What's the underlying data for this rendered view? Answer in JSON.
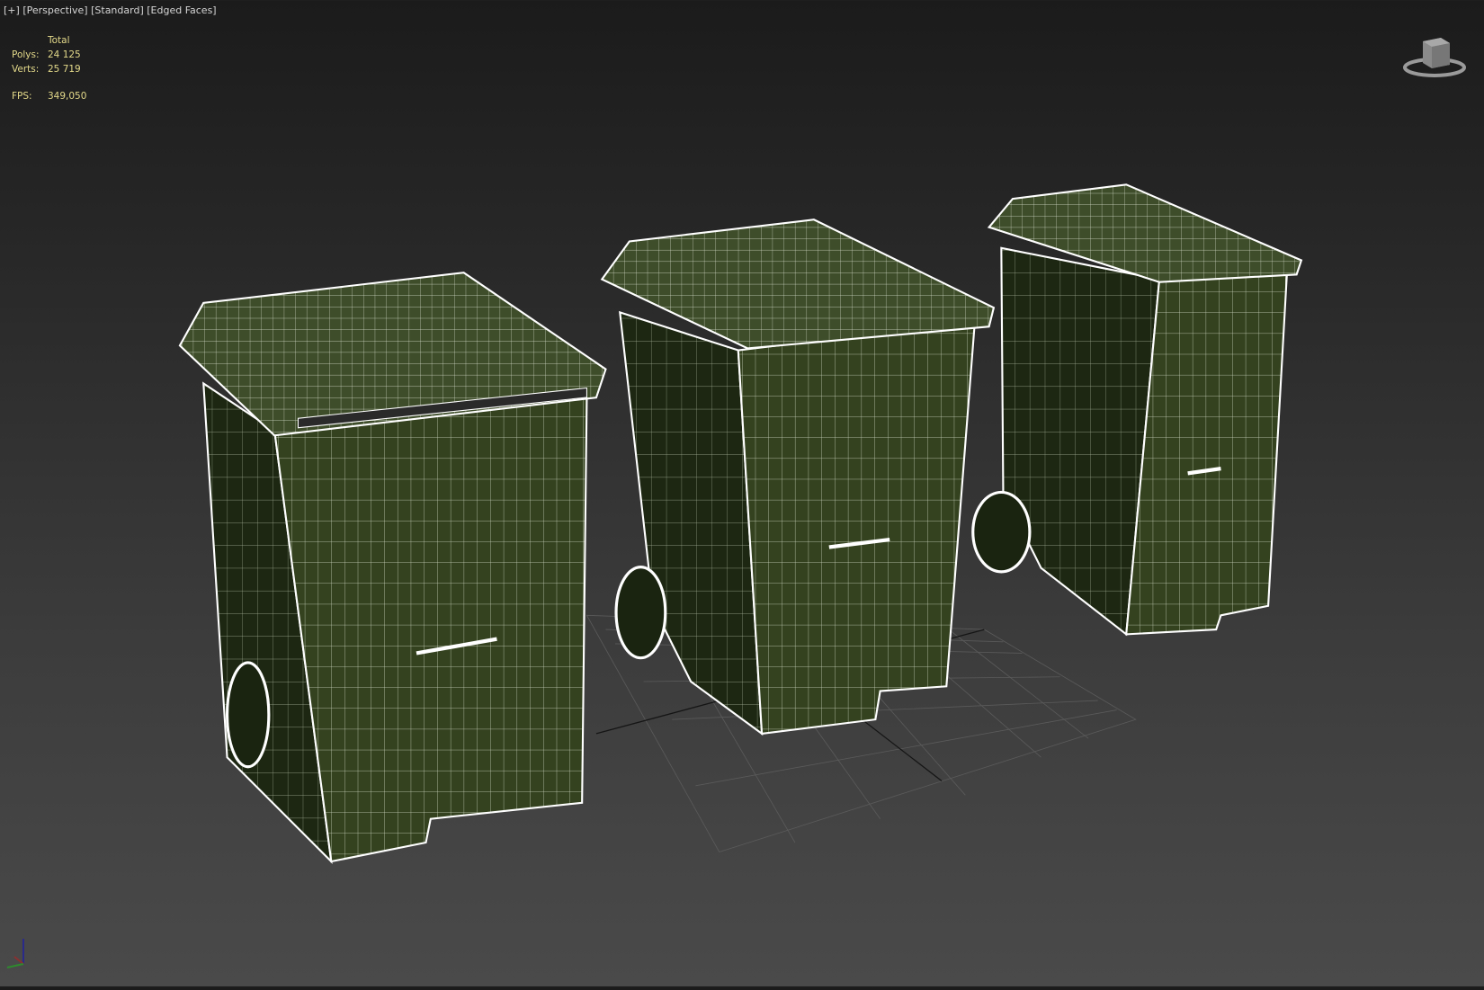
{
  "viewport": {
    "label_plus": "[+]",
    "label_view": "[Perspective]",
    "label_shading": "[Standard]",
    "label_display": "[Edged Faces]"
  },
  "stats": {
    "header": "Total",
    "polys_label": "Polys:",
    "polys_value": "24 125",
    "verts_label": "Verts:",
    "verts_value": "25 719",
    "fps_label": "FPS:",
    "fps_value": "349,050"
  },
  "colors": {
    "stats_text": "#e3d98a",
    "mesh_fill": "#34421f",
    "wire": "#e8eee0"
  }
}
